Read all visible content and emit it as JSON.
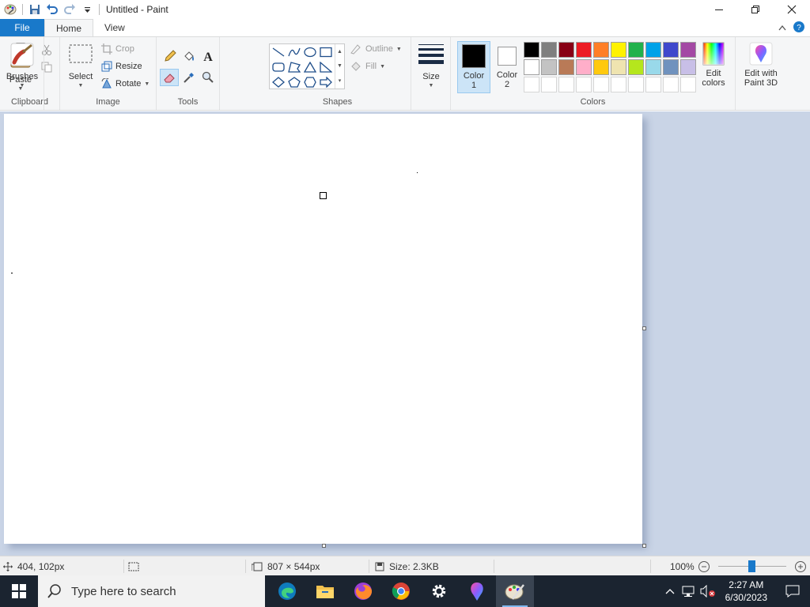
{
  "window": {
    "title": "Untitled - Paint"
  },
  "tabs": {
    "file": "File",
    "home": "Home",
    "view": "View"
  },
  "ribbon": {
    "clipboard": {
      "label": "Clipboard",
      "paste": "Paste"
    },
    "image": {
      "label": "Image",
      "select": "Select",
      "crop": "Crop",
      "resize": "Resize",
      "rotate": "Rotate"
    },
    "tools": {
      "label": "Tools"
    },
    "brushes": {
      "label": "Brushes"
    },
    "shapes": {
      "label": "Shapes",
      "outline": "Outline",
      "fill": "Fill"
    },
    "size": {
      "label": "Size"
    },
    "colors": {
      "label": "Colors",
      "color1_line1": "Color",
      "color1_line2": "1",
      "color2_line1": "Color",
      "color2_line2": "2",
      "color1_value": "#000000",
      "color2_value": "#ffffff",
      "edit_line1": "Edit",
      "edit_line2": "colors",
      "paint3d_line1": "Edit with",
      "paint3d_line2": "Paint 3D",
      "palette_row1": [
        "#000000",
        "#7f7f7f",
        "#880015",
        "#ed1c24",
        "#ff7f27",
        "#fff200",
        "#22b14c",
        "#00a2e8",
        "#3f48cc",
        "#a349a4"
      ],
      "palette_row2": [
        "#ffffff",
        "#c3c3c3",
        "#b97a57",
        "#ffaec9",
        "#ffc90e",
        "#efe4b0",
        "#b5e61d",
        "#99d9ea",
        "#7092be",
        "#c8bfe7"
      ]
    }
  },
  "status": {
    "position": "404, 102px",
    "dimensions": "807 × 544px",
    "size": "Size: 2.3KB",
    "zoom": "100%",
    "zoom_level": 1.0
  },
  "taskbar": {
    "search_placeholder": "Type here to search",
    "time": "2:27 AM",
    "date": "6/30/2023"
  }
}
